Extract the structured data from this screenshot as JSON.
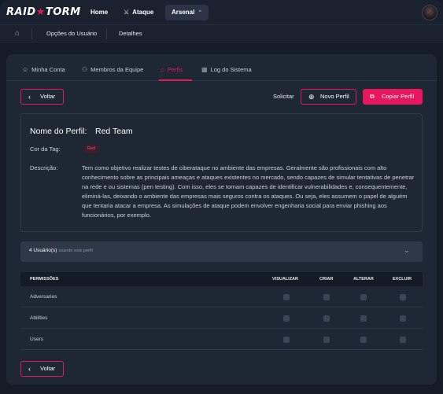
{
  "topnav": {
    "logo_left": "RAID",
    "logo_right": "TORM",
    "logo_star": "★",
    "items": [
      {
        "label": "Home"
      },
      {
        "label": "Ataque",
        "icon": "sword-icon"
      },
      {
        "label": "Arsenal",
        "icon": "chevron-up-icon",
        "active": true
      }
    ]
  },
  "breadcrumb": {
    "home_icon": "home-icon",
    "items": [
      "Opções do Usuário",
      "Detalhes"
    ]
  },
  "tabs": [
    {
      "label": "Minha Conta",
      "icon": "user-icon"
    },
    {
      "label": "Membros da Equipe",
      "icon": "user-plus-icon"
    },
    {
      "label": "Perfis",
      "icon": "profile-icon",
      "active": true
    },
    {
      "label": "Log do Sistema",
      "icon": "calendar-icon"
    }
  ],
  "actions": {
    "back_label": "Voltar",
    "solicitar_label": "Solicitar",
    "novo_label": "Novo Perfil",
    "copiar_label": "Copiar Perfil"
  },
  "profile": {
    "name_label": "Nome do Perfil:",
    "name_value": "Red Team",
    "tag_label": "Cor da Tag:",
    "tag_value": "Red",
    "desc_label": "Descrição:",
    "desc_value": "Tem como objetivo realizar testes de ciberataque no ambiente das empresas. Geralmente são profissionais com alto conhecimento sobre as principais ameaças e ataques existentes no mercado, sendo capazes de simular tentativas de penetrar na rede e ou sistemas (pen testing). Com isso, eles se tornam capazes de identificar vulnerabilidades e, consequentemente, eliminá-las, deixando o ambiente das empresas mais seguros contra os ataques. Ou seja, eles assumem o papel de alguém que tentaria atacar a empresa. As simulações de ataque podem envolver engenharia social para enviar phishing aos funcionários, por exemplo."
  },
  "users": {
    "count_label": "4 Usuário(s)",
    "sub_label": "usando este perfil"
  },
  "permissions": {
    "headers": [
      "PERMISSÕES",
      "VISUALIZAR",
      "CRIAR",
      "ALTERAR",
      "EXCLUIR"
    ],
    "rows": [
      {
        "label": "Adversaries",
        "values": [
          false,
          false,
          false,
          false
        ]
      },
      {
        "label": "Abilities",
        "values": [
          false,
          false,
          false,
          false
        ]
      },
      {
        "label": "Users",
        "values": [
          false,
          false,
          false,
          false
        ]
      }
    ]
  },
  "colors": {
    "accent": "#e8175d",
    "background": "#151c27",
    "card": "#1e2734"
  }
}
